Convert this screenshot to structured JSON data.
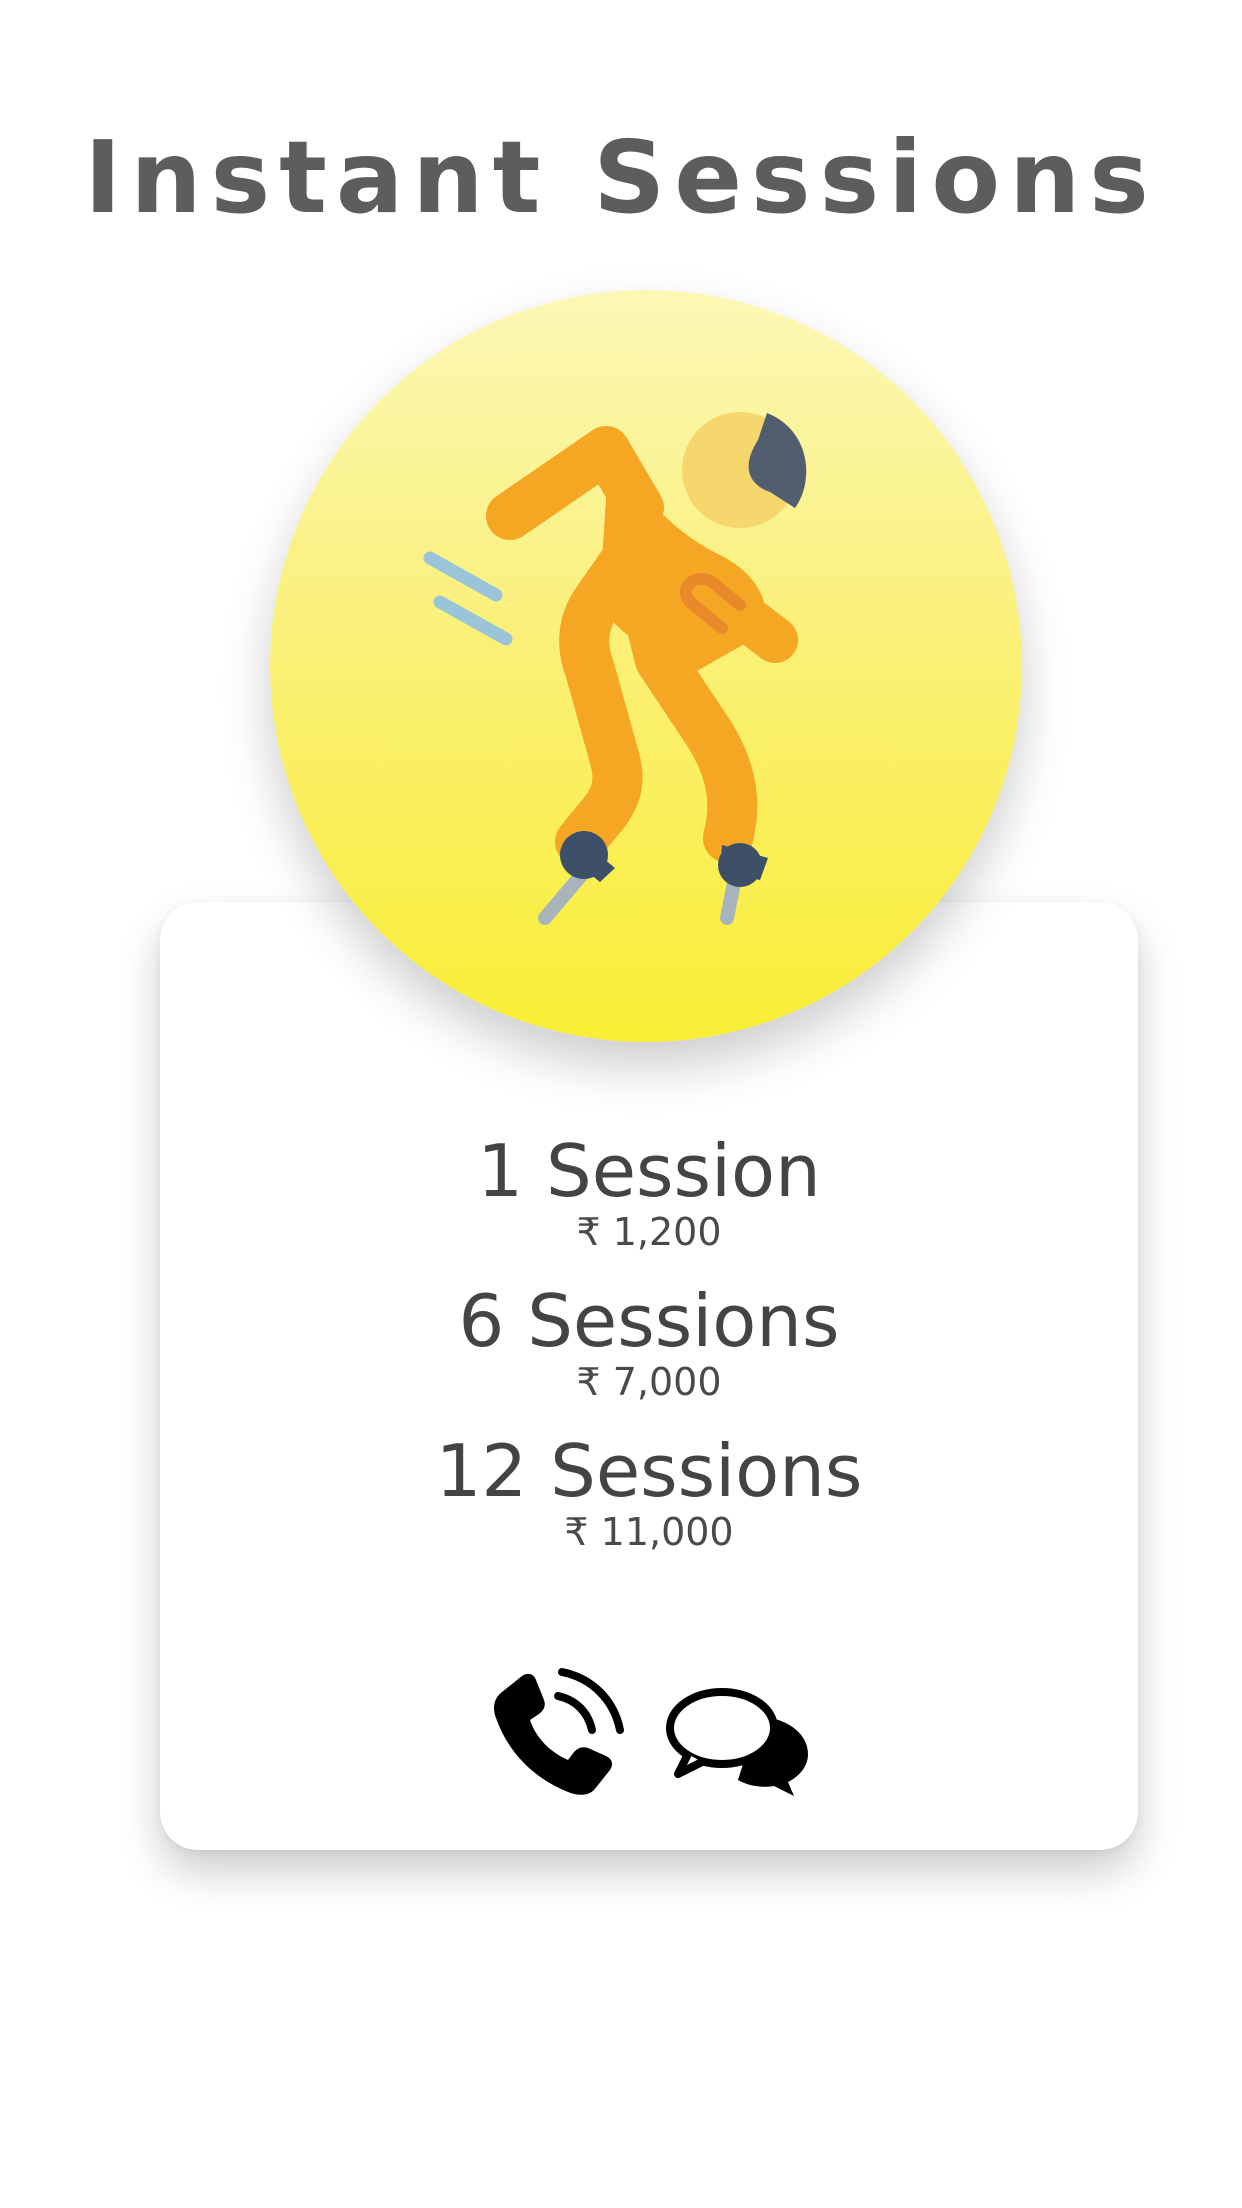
{
  "header": {
    "title": "Instant Sessions"
  },
  "hero": {
    "icon": "skater-icon",
    "gradient_top": "#fbf8b6",
    "gradient_bottom": "#f9ee34"
  },
  "plans": [
    {
      "name": "1 Session",
      "price": "₹ 1,200"
    },
    {
      "name": "6 Sessions",
      "price": "₹ 7,000"
    },
    {
      "name": "12 Sessions",
      "price": "₹ 11,000"
    }
  ],
  "actions": {
    "call_icon": "phone-call-icon",
    "chat_icon": "chat-bubbles-icon"
  }
}
